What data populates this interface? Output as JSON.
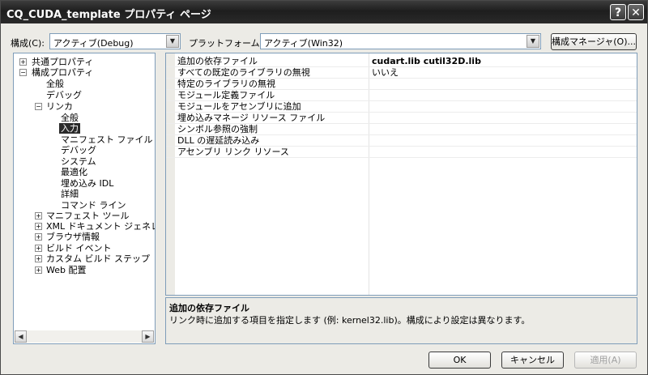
{
  "window": {
    "title": "CQ_CUDA_template プロパティ ページ",
    "help_glyph": "?",
    "close_glyph": "✕"
  },
  "toolbar": {
    "config_label": "構成(C):",
    "config_value": "アクティブ(Debug)",
    "platform_label": "プラットフォーム(P):",
    "platform_value": "アクティブ(Win32)",
    "config_manager_label": "構成マネージャ(O)..."
  },
  "tree": {
    "common": "共通プロパティ",
    "config": "構成プロパティ",
    "general": "全般",
    "debug": "デバッグ",
    "linker": "リンカ",
    "linker_general": "全般",
    "linker_input": "入力",
    "linker_manifest": "マニフェスト ファイル",
    "linker_debug": "デバッグ",
    "linker_system": "システム",
    "linker_optimize": "最適化",
    "linker_idl": "埋め込み IDL",
    "linker_advanced": "詳細",
    "linker_cmdline": "コマンド ライン",
    "manifest_tool": "マニフェスト ツール",
    "xml_doc": "XML ドキュメント ジェネレータ",
    "browse_info": "ブラウザ情報",
    "build_events": "ビルド イベント",
    "custom_build": "カスタム ビルド ステップ",
    "web_deploy": "Web 配置"
  },
  "properties": {
    "rows": [
      {
        "name": "追加の依存ファイル",
        "value": "cudart.lib cutil32D.lib"
      },
      {
        "name": "すべての既定のライブラリの無視",
        "value": "いいえ"
      },
      {
        "name": "特定のライブラリの無視",
        "value": ""
      },
      {
        "name": "モジュール定義ファイル",
        "value": ""
      },
      {
        "name": "モジュールをアセンブリに追加",
        "value": ""
      },
      {
        "name": "埋め込みマネージ リソース ファイル",
        "value": ""
      },
      {
        "name": "シンボル参照の強制",
        "value": ""
      },
      {
        "name": "DLL の遅延読み込み",
        "value": ""
      },
      {
        "name": "アセンブリ リンク リソース",
        "value": ""
      }
    ]
  },
  "description": {
    "title": "追加の依存ファイル",
    "text": "リンク時に追加する項目を指定します (例: kernel32.lib)。構成により設定は異なります。"
  },
  "buttons": {
    "ok": "OK",
    "cancel": "キャンセル",
    "apply": "適用(A)"
  },
  "icons": {
    "expand": "+",
    "collapse": "−",
    "arrow_down": "▼",
    "arrow_left": "◀",
    "arrow_right": "▶"
  }
}
